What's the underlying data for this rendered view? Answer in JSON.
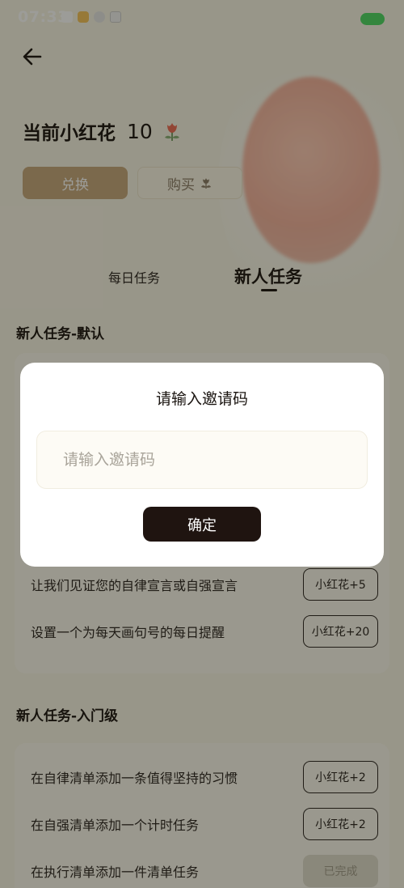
{
  "status_bar": {
    "time": "07:33"
  },
  "header": {
    "flower_label": "当前小红花",
    "flower_count": "10"
  },
  "actions": {
    "exchange_label": "兑换",
    "buy_label": "购买"
  },
  "tabs": [
    {
      "label": "每日任务",
      "active": false
    },
    {
      "label": "新人任务",
      "active": true
    }
  ],
  "sections": [
    {
      "title": "新人任务-默认",
      "tasks": [
        {
          "text": "让我们见证您的自律宣言或自强宣言",
          "reward": "小红花+5"
        },
        {
          "text": "设置一个为每天画句号的每日提醒",
          "reward": "小红花+20"
        }
      ]
    },
    {
      "title": "新人任务-入门级",
      "tasks": [
        {
          "text": "在自律清单添加一条值得坚持的习惯",
          "reward": "小红花+2"
        },
        {
          "text": "在自强清单添加一个计时任务",
          "reward": "小红花+2"
        },
        {
          "text": "在执行清单添加一件清单任务",
          "reward": "已完成",
          "done": true
        }
      ]
    }
  ],
  "dialog": {
    "title": "请输入邀请码",
    "input_placeholder": "请输入邀请码",
    "input_value": "",
    "confirm_label": "确定"
  },
  "colors": {
    "accent_gold": "#c7a87d",
    "dark_button": "#1f1410",
    "battery": "#4cd964"
  }
}
